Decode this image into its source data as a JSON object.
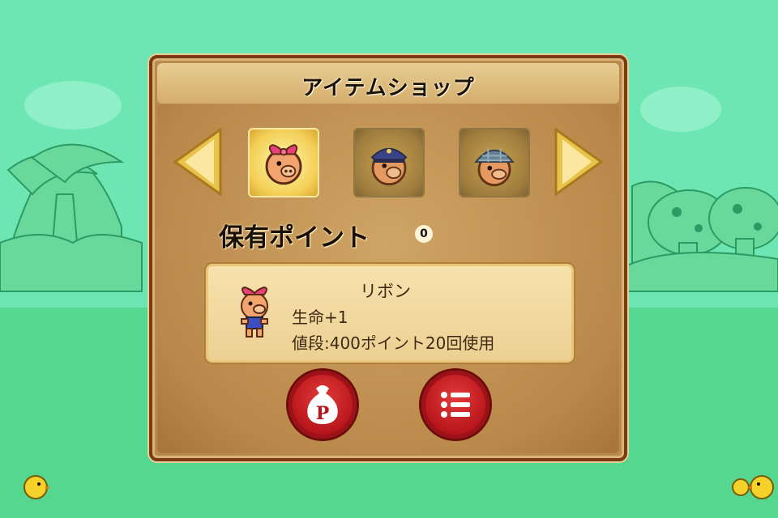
{
  "shop": {
    "title": "アイテムショップ",
    "points_label": "保有ポイント",
    "points_value": "0",
    "items": [
      {
        "icon": "pig-ribbon-icon",
        "selected": true
      },
      {
        "icon": "pig-police-cap-icon",
        "selected": false
      },
      {
        "icon": "pig-helmet-icon",
        "selected": false
      }
    ],
    "detail": {
      "name": "リボン",
      "stat": "生命+1",
      "price": "値段:400ポイント20回使用",
      "icon": "pig-ribbon-full-body-icon"
    },
    "buttons": [
      {
        "icon": "money-bag-p-icon"
      },
      {
        "icon": "list-icon"
      }
    ],
    "arrows": [
      {
        "icon": "arrow-left-icon"
      },
      {
        "icon": "arrow-right-icon"
      }
    ]
  },
  "colors": {
    "background": "#6ee6b4",
    "panel_border": "#7a3a12",
    "panel": "#b88a4c",
    "button_red": "#b8161b"
  }
}
